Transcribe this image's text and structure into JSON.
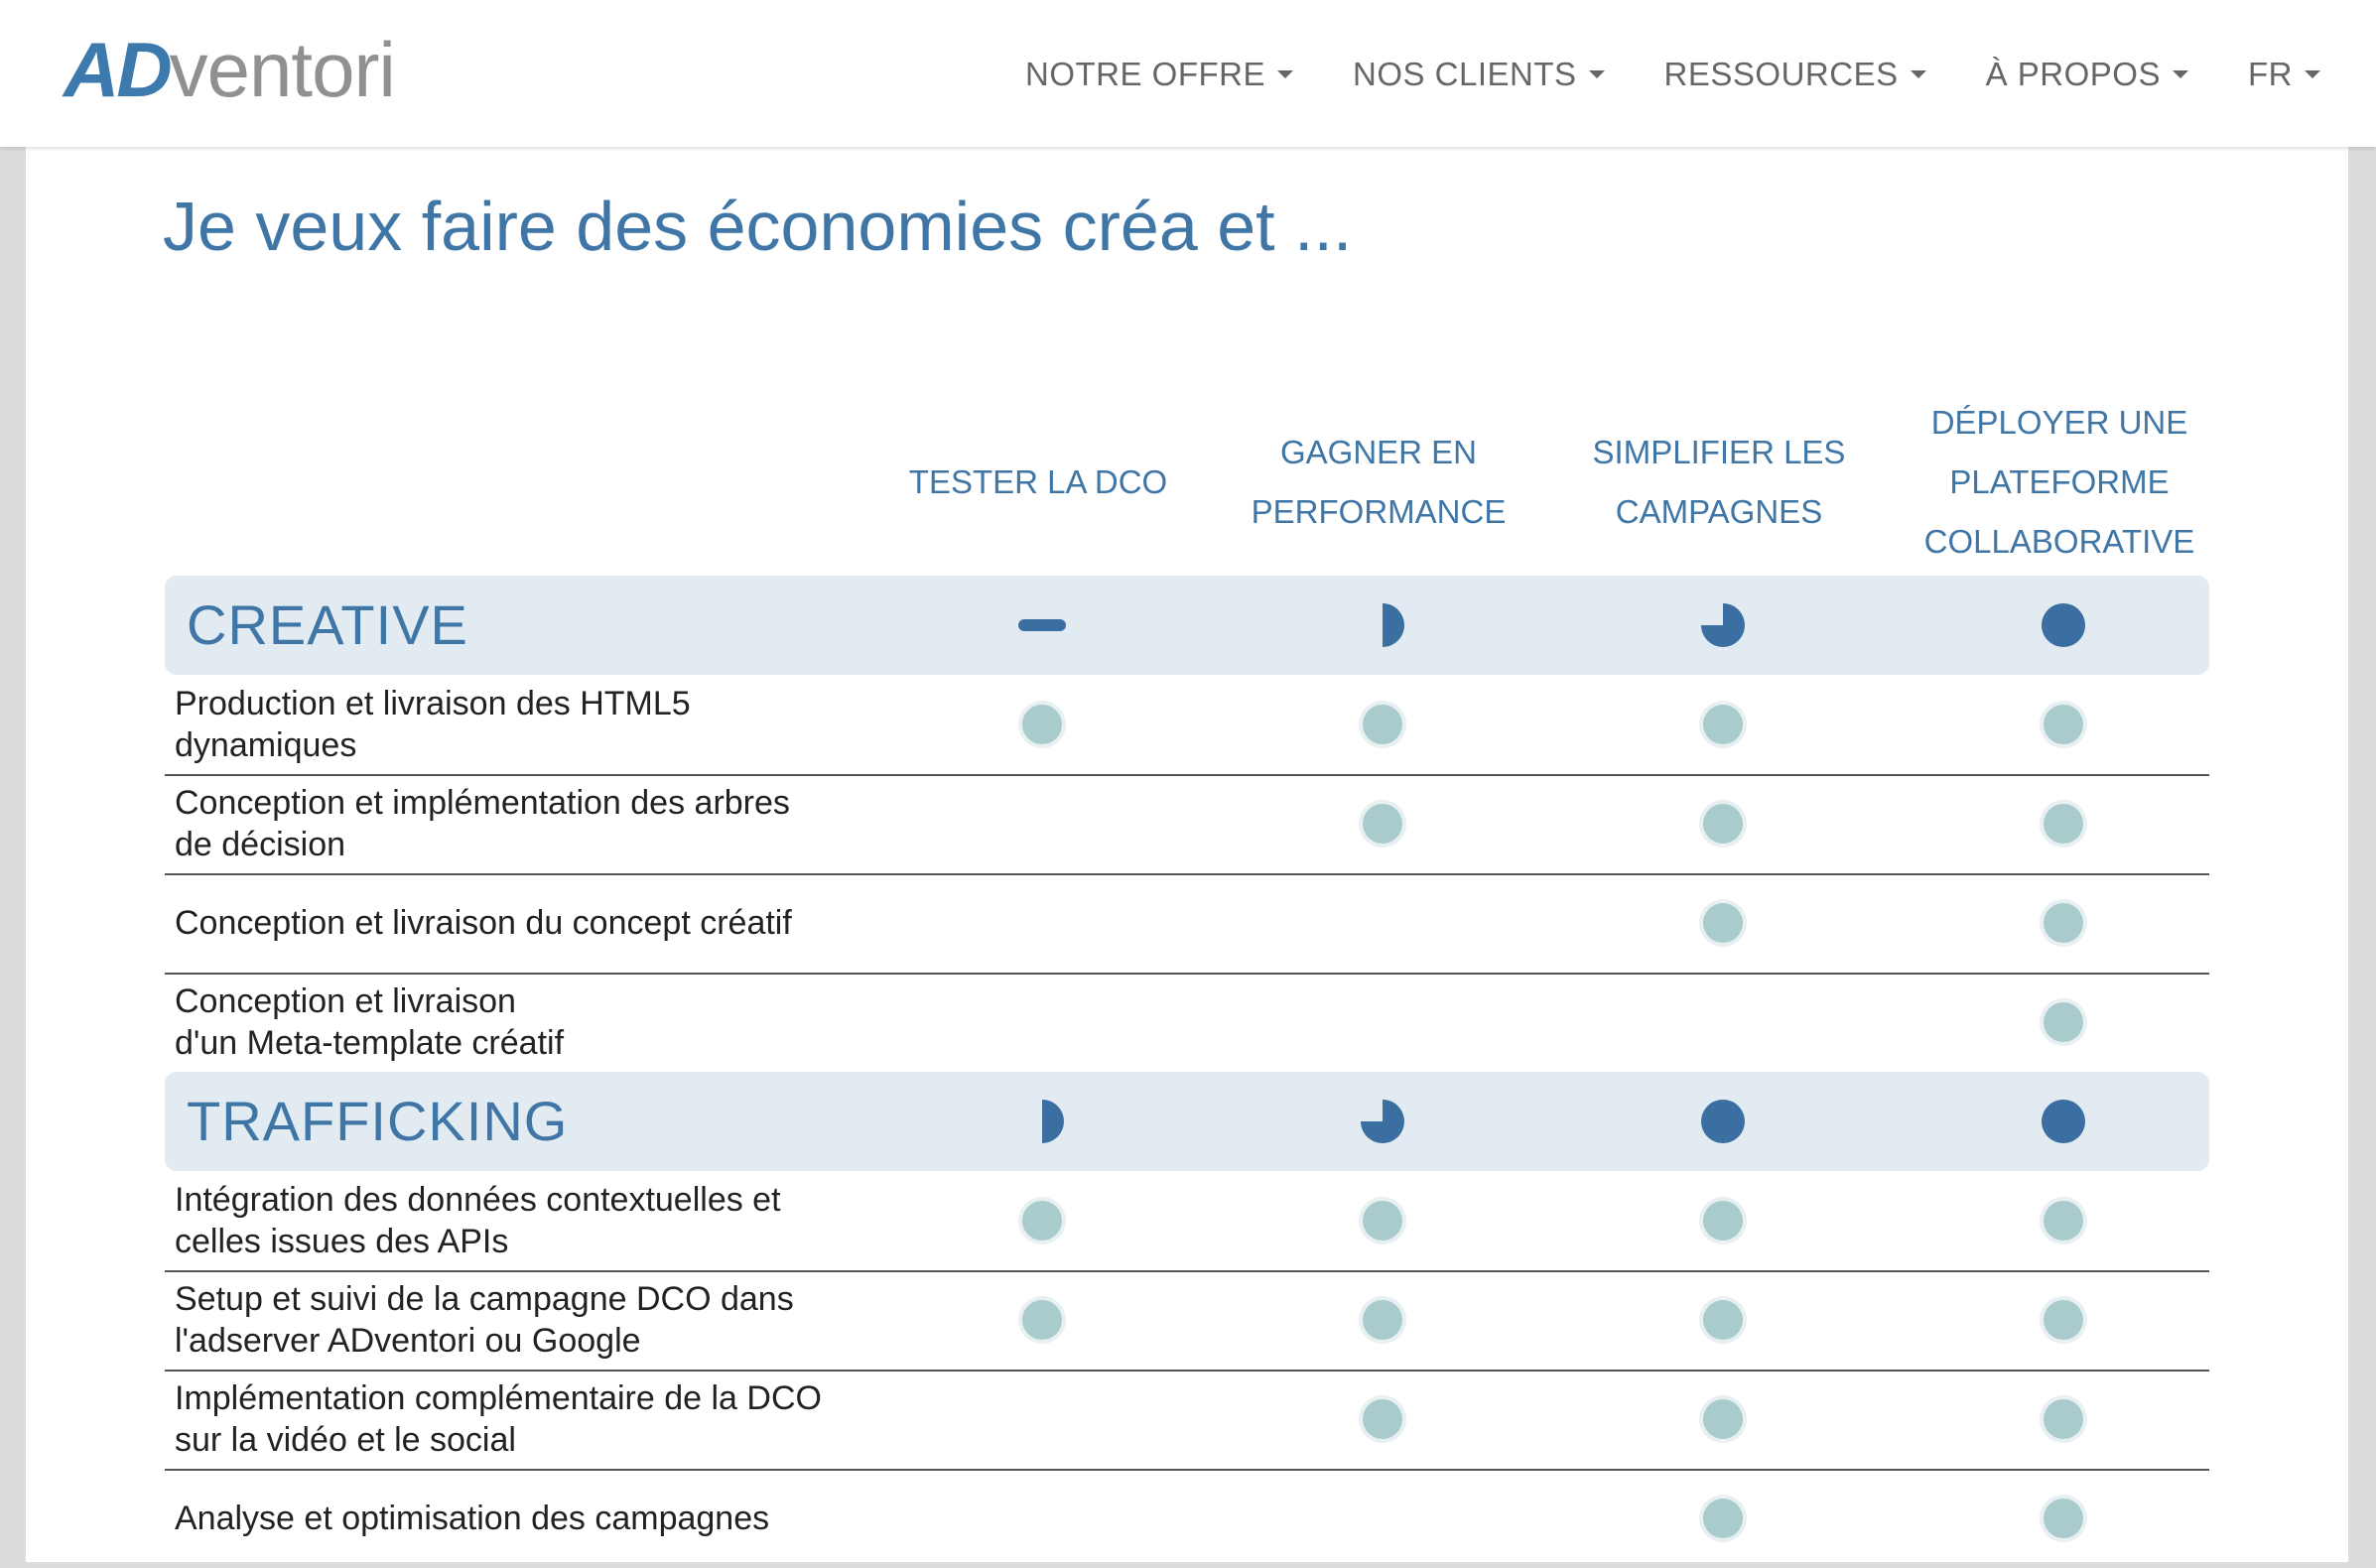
{
  "header": {
    "logo": {
      "part1": "AD",
      "part2": "ventori"
    },
    "nav": [
      {
        "label": "NOTRE OFFRE"
      },
      {
        "label": "NOS CLIENTS"
      },
      {
        "label": "RESSOURCES"
      },
      {
        "label": "À PROPOS"
      },
      {
        "label": "FR"
      }
    ]
  },
  "page": {
    "title": "Je veux faire des économies créa et ..."
  },
  "colors": {
    "accent": "#3f76a6",
    "indicator_dark": "#3c6fa1",
    "dot_fill": "#a9cbcc",
    "band": "#e2ebf2"
  },
  "columns": [
    {
      "label": "TESTER LA DCO"
    },
    {
      "label": "GAGNER EN PERFORMANCE"
    },
    {
      "label": "SIMPLIFIER LES CAMPAGNES"
    },
    {
      "label": "DÉPLOYER UNE PLATEFORME COLLABORATIVE"
    }
  ],
  "sections": [
    {
      "title": "CREATIVE",
      "levels": [
        0,
        0.5,
        0.75,
        1
      ],
      "rows": [
        {
          "label": "Production et livraison des HTML5\ndynamiques",
          "checks": [
            true,
            true,
            true,
            true
          ]
        },
        {
          "label": "Conception et implémentation des arbres\nde décision",
          "checks": [
            false,
            true,
            true,
            true
          ]
        },
        {
          "label": "Conception et livraison du concept créatif",
          "checks": [
            false,
            false,
            true,
            true
          ]
        },
        {
          "label": "Conception et livraison\nd'un Meta-template créatif",
          "checks": [
            false,
            false,
            false,
            true
          ]
        }
      ]
    },
    {
      "title": "TRAFFICKING",
      "levels": [
        0.5,
        0.75,
        1,
        1
      ],
      "rows": [
        {
          "label": "Intégration des données contextuelles et\ncelles issues des APIs",
          "checks": [
            true,
            true,
            true,
            true
          ]
        },
        {
          "label": "Setup et suivi de la campagne DCO dans\nl'adserver ADventori ou Google",
          "checks": [
            true,
            true,
            true,
            true
          ]
        },
        {
          "label": "Implémentation complémentaire de la DCO\nsur la vidéo et le social",
          "checks": [
            false,
            true,
            true,
            true
          ]
        },
        {
          "label": "Analyse et optimisation des campagnes",
          "checks": [
            false,
            false,
            true,
            true
          ]
        }
      ]
    }
  ]
}
